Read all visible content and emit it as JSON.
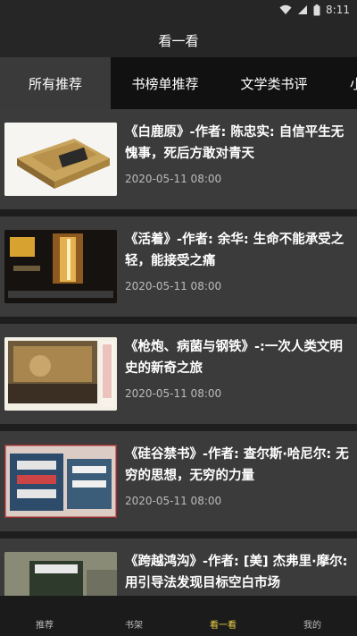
{
  "status_bar": {
    "time": "8:11",
    "icons": [
      "wifi-icon",
      "signal-icon",
      "battery-icon"
    ]
  },
  "header": {
    "title": "看一看"
  },
  "tabs": [
    {
      "label": "所有推荐",
      "active": true
    },
    {
      "label": "书榜单推荐",
      "active": false
    },
    {
      "label": "文学类书评",
      "active": false
    },
    {
      "label": "小",
      "active": false
    }
  ],
  "articles": [
    {
      "title": "《白鹿原》-作者: 陈忠实: 自信平生无愧事，死后方敢对青天",
      "date": "2020-05-11 08:00",
      "thumb": "bai-lu-yuan-cover"
    },
    {
      "title": "《活着》-作者: 余华: 生命不能承受之轻，能接受之痛",
      "date": "2020-05-11 08:00",
      "thumb": "huo-zhe-cover"
    },
    {
      "title": "《枪炮、病菌与钢铁》-:一次人类文明史的新奇之旅",
      "date": "2020-05-11 08:00",
      "thumb": "guns-germs-steel-cover"
    },
    {
      "title": "《硅谷禁书》-作者: 查尔斯·哈尼尔: 无穷的思想，无穷的力量",
      "date": "2020-05-11 08:00",
      "thumb": "silicon-valley-books-cover"
    },
    {
      "title": "《跨越鸿沟》-作者: [美] 杰弗里·摩尔: 用引导法发现目标空白市场",
      "date": "",
      "thumb": "crossing-chasm-cover"
    }
  ],
  "bottom_nav": [
    {
      "label": "推荐",
      "active": false
    },
    {
      "label": "书架",
      "active": false
    },
    {
      "label": "看一看",
      "active": true
    },
    {
      "label": "我的",
      "active": false
    }
  ],
  "colors": {
    "accent": "#f2d54a",
    "card_bg": "#3b3b3b",
    "header_bg": "#262626"
  }
}
